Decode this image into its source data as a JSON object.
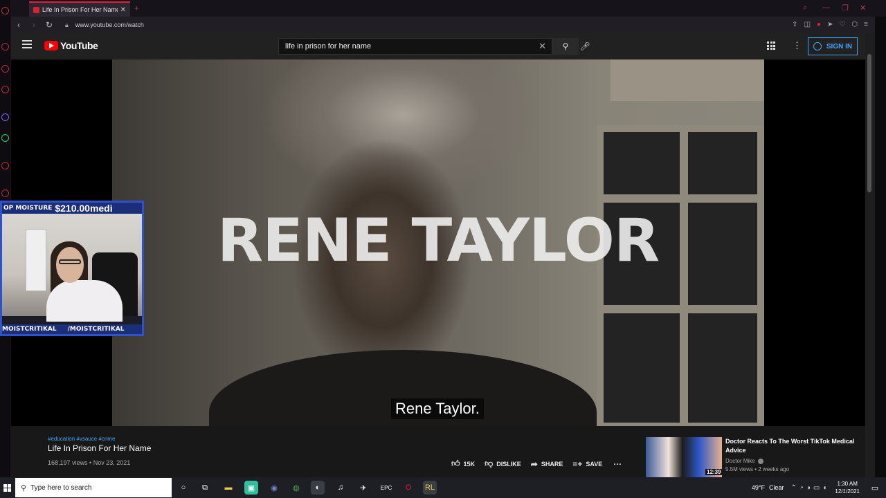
{
  "browser": {
    "tab_title": "Life In Prison For Her Name",
    "tab_close": "✕",
    "new_tab": "+",
    "url": "www.youtube.com/watch"
  },
  "youtube": {
    "logo_text": "YouTube",
    "search_value": "life in prison for her name",
    "sign_in_label": "SIGN IN"
  },
  "video": {
    "overlay_title": "RENE TAYLOR",
    "caption": "Rene Taylor."
  },
  "webcam": {
    "ticker_text": "OP MOISTURE",
    "donation_amount": "$210.00medi",
    "handle_left": "MOISTCRITIKAL",
    "handle_right": "/MOISTCRITIKAL"
  },
  "details": {
    "tags": "#education #vsauce #crime",
    "title": "Life In Prison For Her Name",
    "meta": "168,197 views • Nov 23, 2021",
    "like_count": "15K",
    "dislike_label": "DISLIKE",
    "share_label": "SHARE",
    "save_label": "SAVE"
  },
  "next_video": {
    "title": "Doctor Reacts To The Worst TikTok Medical Advice",
    "channel": "Doctor Mike",
    "stats": "5.5M views • 2 weeks ago",
    "duration": "12:39"
  },
  "taskbar": {
    "search_placeholder": "Type here to search",
    "temperature": "49°F",
    "condition": "Clear",
    "time": "1:30 AM",
    "date": "12/1/2021"
  },
  "colors": {
    "youtube_red": "#ff0000",
    "opera_red": "#e0203b",
    "link_blue": "#3ea6ff",
    "webcam_border": "#2f52c9"
  },
  "icons": [
    "hamburger-menu-icon",
    "search-icon",
    "mic-icon",
    "apps-grid-icon",
    "more-vert-icon",
    "thumbs-up-icon",
    "thumbs-down-icon",
    "share-icon",
    "save-playlist-icon",
    "windows-logo-icon"
  ]
}
